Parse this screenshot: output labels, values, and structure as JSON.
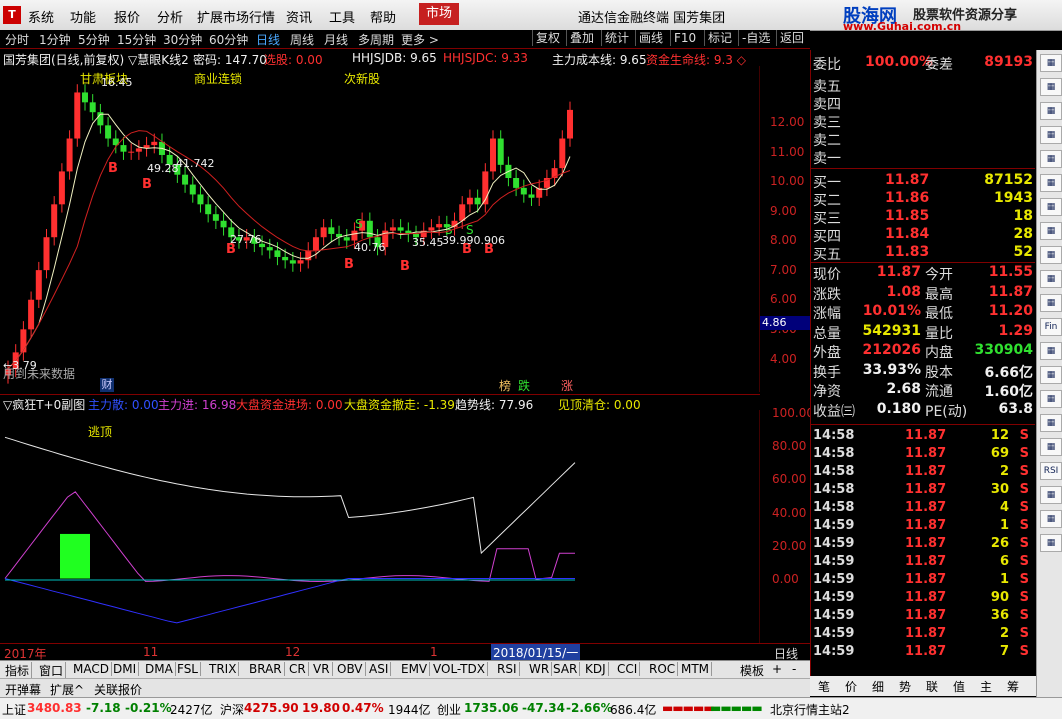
{
  "menubar": {
    "items": [
      "系统",
      "功能",
      "报价",
      "分析",
      "扩展市场行情",
      "资讯",
      "工具",
      "帮助"
    ],
    "market_label": "市场",
    "title": "通达信金融终端  国芳集团",
    "brand_top": "股海网",
    "brand_tag": "股票软件资源分享",
    "brand_url": "www.Guhai.com.cn"
  },
  "toolbar": {
    "periods": [
      "分时",
      "1分钟",
      "5分钟",
      "15分钟",
      "30分钟",
      "60分钟",
      "日线",
      "周线",
      "月线",
      "多周期",
      "更多 >"
    ],
    "buttons": [
      "复权",
      "叠加",
      "统计",
      "画线",
      "F10",
      "标记",
      "-自选",
      "返回"
    ]
  },
  "chart_info": {
    "stock_title": "国芳集团(日线,前复权) ▽慧眼K线2",
    "mima": "密码: 147.70",
    "xuangu": "选股: 0.00",
    "hhjsjdb": "HHJSJDB: 9.65",
    "hhjsjdc": "HHJSJDC: 9.33",
    "zlcb": "主力成本线: 9.65",
    "zjsm": "资金生命线: 9.3 ◇",
    "tags": [
      "甘肃板块",
      "商业连锁",
      "次新股"
    ],
    "level_labels": [
      "49.28",
      "41.742",
      "27.76",
      "40.76",
      "35.45",
      "39.990.906",
      "16.45"
    ],
    "future_label": "用到未来数据",
    "low_label": "←3.79",
    "cai_badge": "财",
    "badges": [
      "榜",
      "跌",
      "涨"
    ],
    "last_price_tag": "4.86"
  },
  "price_axis": [
    "12.00",
    "11.00",
    "10.00",
    "9.00",
    "8.00",
    "7.00",
    "6.00",
    "5.00",
    "4.00"
  ],
  "chart_data": [
    {
      "type": "candlestick",
      "title": "国芳集团(日线,前复权)",
      "series": [
        {
          "name": "主力成本线",
          "last": 9.65
        },
        {
          "name": "资金生命线",
          "last": 9.33
        }
      ],
      "ylim": [
        3.79,
        12.3
      ],
      "x_ticks": [
        "2017年",
        "11",
        "12",
        "1",
        "2018/01/15/一"
      ],
      "closes": [
        4.0,
        4.5,
        5.2,
        6.1,
        7.0,
        8.0,
        9.0,
        10.0,
        11.0,
        12.4,
        12.1,
        11.8,
        11.4,
        11.0,
        10.8,
        10.6,
        10.6,
        10.7,
        10.8,
        10.9,
        10.5,
        10.2,
        9.9,
        9.6,
        9.3,
        9.0,
        8.7,
        8.5,
        8.3,
        8.0,
        7.9,
        8.0,
        7.8,
        7.7,
        7.6,
        7.4,
        7.3,
        7.2,
        7.3,
        7.6,
        8.0,
        8.3,
        8.1,
        8.0,
        7.9,
        8.2,
        8.5,
        8.0,
        7.7,
        8.2,
        8.3,
        8.2,
        8.1,
        8.0,
        8.2,
        8.3,
        8.4,
        8.3,
        8.5,
        9.0,
        9.2,
        9.0,
        10.0,
        11.0,
        10.2,
        9.8,
        9.5,
        9.3,
        9.2,
        9.5,
        9.8,
        10.1,
        11.0,
        11.87
      ]
    },
    {
      "type": "line",
      "title": "▽疯狂T+0副图",
      "ylim": [
        -40,
        110
      ],
      "series": [
        {
          "name": "主力散",
          "last": 0.0
        },
        {
          "name": "主力进",
          "last": 16.98
        },
        {
          "name": "大盘资金进场",
          "last": 0.0
        },
        {
          "name": "大盘资金撤走",
          "last": -1.39
        },
        {
          "name": "趋势线",
          "last": 77.96
        },
        {
          "name": "见顶清仓",
          "last": 0.0
        }
      ],
      "y_ticks": [
        "100.00",
        "80.00",
        "60.00",
        "40.00",
        "20.00",
        "0.00"
      ],
      "label": "逃顶"
    }
  ],
  "indicator": {
    "name": "▽疯狂T+0副图",
    "zls": "主力散: 0.00",
    "zlj": "主力进: 16.98",
    "dpjc": "大盘资金进场: 0.00",
    "dpcz": "大盘资金撤走: -1.39",
    "qsx": "趋势线: 77.96",
    "jdqc": "见顶清仓: 0.00",
    "taoding": "逃顶"
  },
  "osc_axis": [
    "100.00",
    "80.00",
    "60.00",
    "40.00",
    "20.00",
    "0.00"
  ],
  "dates": {
    "d1": "2017年",
    "d2": "11",
    "d3": "12",
    "d4": "1",
    "d5": "2018/01/15/一",
    "period": "日线"
  },
  "bottom_tabs": [
    "指标",
    "窗口",
    "MACD",
    "DMI",
    "DMA",
    "FSL",
    "TRIX",
    "BRAR",
    "CR",
    "VR",
    "OBV",
    "ASI",
    "EMV",
    "VOL-TDX",
    "RSI",
    "WR",
    "SAR",
    "KDJ",
    "CCI",
    "ROC",
    "MTM"
  ],
  "bottom_tabs_right": [
    "模板",
    "+",
    "-"
  ],
  "sub_tabs": [
    "开弹幕",
    "扩展^",
    "关联报价"
  ],
  "quote": {
    "wb_label": "委比",
    "wb_value": "100.00%",
    "wc_label": "委差",
    "wc_value": "89193",
    "sells": [
      "卖五",
      "卖四",
      "卖三",
      "卖二",
      "卖一"
    ],
    "buys": [
      {
        "label": "买一",
        "price": "11.87",
        "vol": "87152"
      },
      {
        "label": "买二",
        "price": "11.86",
        "vol": "1943"
      },
      {
        "label": "买三",
        "price": "11.85",
        "vol": "18"
      },
      {
        "label": "买四",
        "price": "11.84",
        "vol": "28"
      },
      {
        "label": "买五",
        "price": "11.83",
        "vol": "52"
      }
    ],
    "stats": [
      {
        "l": "现价",
        "v": "11.87",
        "l2": "今开",
        "v2": "11.55"
      },
      {
        "l": "涨跌",
        "v": "1.08",
        "l2": "最高",
        "v2": "11.87"
      },
      {
        "l": "涨幅",
        "v": "10.01%",
        "l2": "最低",
        "v2": "11.20"
      },
      {
        "l": "总量",
        "v": "542931",
        "l2": "量比",
        "v2": "1.29"
      },
      {
        "l": "外盘",
        "v": "212026",
        "l2": "内盘",
        "v2": "330904"
      },
      {
        "l": "换手",
        "v": "33.93%",
        "l2": "股本",
        "v2": "6.66亿"
      },
      {
        "l": "净资",
        "v": "2.68",
        "l2": "流通",
        "v2": "1.60亿"
      },
      {
        "l": "收益㈢",
        "v": "0.180",
        "l2": "PE(动)",
        "v2": "63.8"
      }
    ],
    "ticks": [
      {
        "t": "14:58",
        "p": "11.87",
        "q": "12",
        "s": "S"
      },
      {
        "t": "14:58",
        "p": "11.87",
        "q": "69",
        "s": "S"
      },
      {
        "t": "14:58",
        "p": "11.87",
        "q": "2",
        "s": "S"
      },
      {
        "t": "14:58",
        "p": "11.87",
        "q": "30",
        "s": "S"
      },
      {
        "t": "14:58",
        "p": "11.87",
        "q": "4",
        "s": "S"
      },
      {
        "t": "14:59",
        "p": "11.87",
        "q": "1",
        "s": "S"
      },
      {
        "t": "14:59",
        "p": "11.87",
        "q": "26",
        "s": "S"
      },
      {
        "t": "14:59",
        "p": "11.87",
        "q": "6",
        "s": "S"
      },
      {
        "t": "14:59",
        "p": "11.87",
        "q": "1",
        "s": "S"
      },
      {
        "t": "14:59",
        "p": "11.87",
        "q": "90",
        "s": "S"
      },
      {
        "t": "14:59",
        "p": "11.87",
        "q": "36",
        "s": "S"
      },
      {
        "t": "14:59",
        "p": "11.87",
        "q": "2",
        "s": "S"
      },
      {
        "t": "14:59",
        "p": "11.87",
        "q": "7",
        "s": "S"
      }
    ],
    "tabs": [
      "笔",
      "价",
      "细",
      "势",
      "联",
      "值",
      "主",
      "筹"
    ]
  },
  "side_buttons": [
    "",
    "",
    "",
    "",
    "",
    "",
    "",
    "",
    "",
    "",
    "",
    "Fin",
    "",
    "",
    "",
    "",
    "",
    "RSI",
    "",
    "",
    ""
  ],
  "status": {
    "sh_label": "上证",
    "sh_val": "3480.83",
    "sh_chg": "-7.18",
    "sh_pct": "-0.21%",
    "sh_amt": "2427亿",
    "sz_label": "沪深",
    "sz_val": "4275.90",
    "sz_chg": "19.80",
    "sz_pct": "0.47%",
    "sz_amt": "1944亿",
    "cy_label": "创业",
    "cy_val": "1735.06",
    "cy_chg": "-47.34",
    "cy_pct": "-2.66%",
    "cy_amt": "686.4亿",
    "server": "北京行情主站2"
  },
  "colors": {
    "up": "#ff3030",
    "down": "#30e030",
    "ma_white": "#f0f0c0",
    "ma_red": "#d02020",
    "bg": "#000000"
  }
}
